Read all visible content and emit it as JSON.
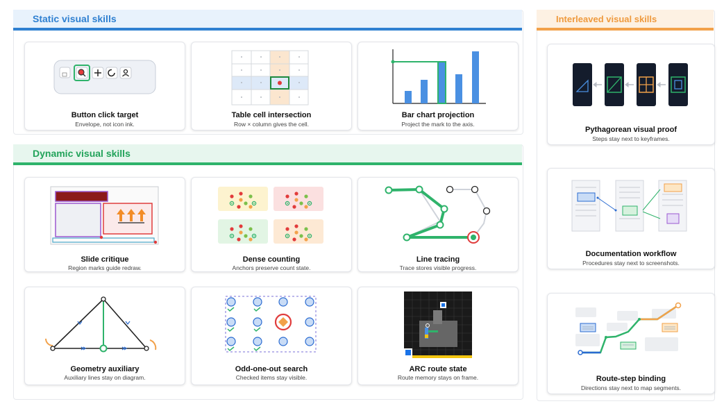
{
  "sections": {
    "static": {
      "title": "Static visual skills",
      "color": "#2f80d1",
      "bg": "#e8f2fc"
    },
    "dynamic": {
      "title": "Dynamic visual skills",
      "color": "#2fb36b",
      "bg": "#e7f6ee"
    },
    "interleaved": {
      "title": "Interleaved visual skills",
      "color": "#f2a14a",
      "bg": "#fdf1e3"
    }
  },
  "cards": {
    "button": {
      "title": "Button click target",
      "subtitle": "Envelope, not icon ink."
    },
    "table": {
      "title": "Table cell intersection",
      "subtitle": "Row × column gives the cell."
    },
    "bar": {
      "title": "Bar chart projection",
      "subtitle": "Project the mark to the axis."
    },
    "slide": {
      "title": "Slide critique",
      "subtitle": "Region marks guide redraw."
    },
    "dense": {
      "title": "Dense counting",
      "subtitle": "Anchors preserve count state."
    },
    "line": {
      "title": "Line tracing",
      "subtitle": "Trace stores visible progress."
    },
    "geometry": {
      "title": "Geometry auxiliary",
      "subtitle": "Auxiliary lines stay on diagram."
    },
    "odd": {
      "title": "Odd-one-out search",
      "subtitle": "Checked items stay visible."
    },
    "arc": {
      "title": "ARC route state",
      "subtitle": "Route memory stays on frame."
    },
    "pyth": {
      "title": "Pythagorean visual proof",
      "subtitle": "Steps stay next to keyframes."
    },
    "doc": {
      "title": "Documentation workflow",
      "subtitle": "Procedures stay next to screenshots."
    },
    "route": {
      "title": "Route-step binding",
      "subtitle": "Directions stay next to map segments."
    }
  }
}
